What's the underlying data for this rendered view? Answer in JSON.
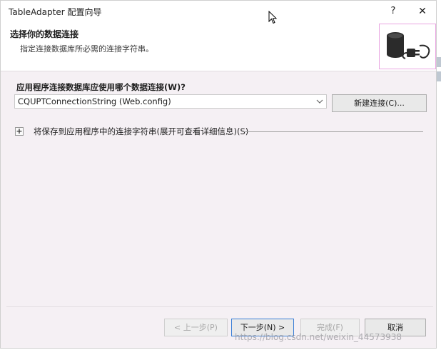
{
  "window": {
    "title": "TableAdapter 配置向导",
    "help_label": "?",
    "close_label": "✕"
  },
  "header": {
    "title": "选择你的数据连接",
    "subtitle": "指定连接数据库所必需的连接字符串。",
    "image_icon": "database-plug-icon"
  },
  "main": {
    "question": "应用程序连接数据库应使用哪个数据连接(W)?",
    "connection_value": "CQUPTConnectionString (Web.config)",
    "new_connection_label": "新建连接(C)...",
    "expander_symbol": "+",
    "expander_label": "将保存到应用程序中的连接字符串(展开可查看详细信息)(S)"
  },
  "footer": {
    "prev_label": "< 上一步(P)",
    "next_label": "下一步(N) >",
    "finish_label": "完成(F)",
    "cancel_label": "取消"
  },
  "watermark": "https://blog.csdn.net/weixin_44573938",
  "colors": {
    "window_bg": "#f5f0f4",
    "header_bg": "#ffffff",
    "image_border": "#e9a6e2",
    "primary_border": "#3b7fd6"
  }
}
